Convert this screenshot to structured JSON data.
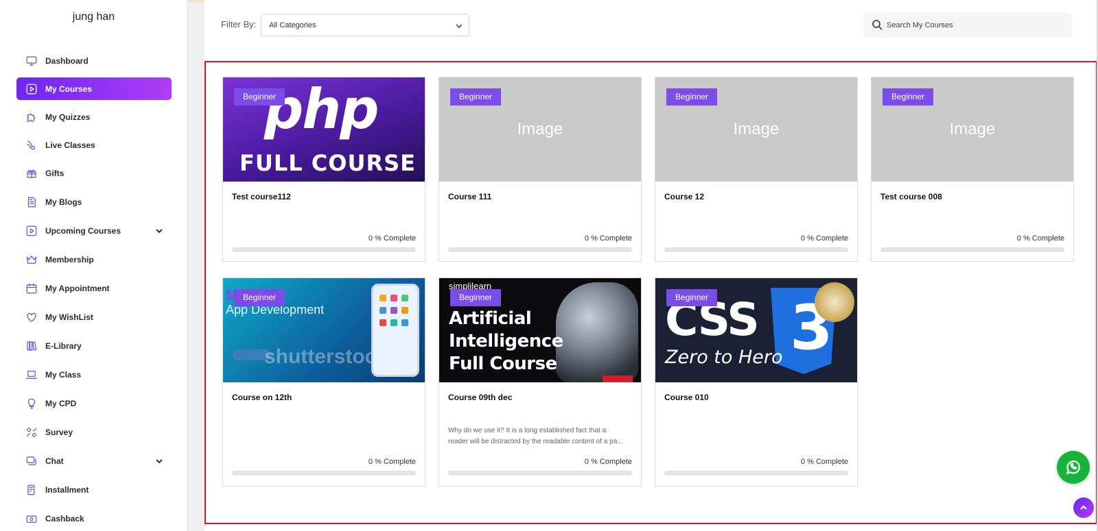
{
  "user": {
    "name": "jung han"
  },
  "sidebar": {
    "items": [
      {
        "label": "Dashboard",
        "icon": "monitor-icon",
        "active": false
      },
      {
        "label": "My Courses",
        "icon": "play-square-icon",
        "active": true
      },
      {
        "label": "My Quizzes",
        "icon": "puzzle-icon",
        "active": false
      },
      {
        "label": "Live Classes",
        "icon": "live-icon",
        "active": false
      },
      {
        "label": "Gifts",
        "icon": "gift-icon",
        "active": false
      },
      {
        "label": "My Blogs",
        "icon": "blog-icon",
        "active": false
      },
      {
        "label": "Upcoming Courses",
        "icon": "play-square-icon",
        "active": false,
        "expandable": true
      },
      {
        "label": "Membership",
        "icon": "crown-icon",
        "active": false
      },
      {
        "label": "My Appointment",
        "icon": "calendar-icon",
        "active": false
      },
      {
        "label": "My WishList",
        "icon": "heart-icon",
        "active": false
      },
      {
        "label": "E-Library",
        "icon": "books-icon",
        "active": false
      },
      {
        "label": "My Class",
        "icon": "laptop-icon",
        "active": false
      },
      {
        "label": "My CPD",
        "icon": "bulb-icon",
        "active": false
      },
      {
        "label": "Survey",
        "icon": "survey-icon",
        "active": false
      },
      {
        "label": "Chat",
        "icon": "chat-icon",
        "active": false,
        "expandable": true
      },
      {
        "label": "Installment",
        "icon": "installment-icon",
        "active": false
      },
      {
        "label": "Cashback",
        "icon": "cashback-icon",
        "active": false
      }
    ]
  },
  "filter": {
    "label": "Filter By:",
    "selected": "All Categories"
  },
  "search": {
    "placeholder": "Search My Courses"
  },
  "courses": [
    {
      "title": "Test course112",
      "level": "Beginner",
      "thumbnail": "php-full-course",
      "progress": 0,
      "progress_text": "0 % Complete",
      "description": ""
    },
    {
      "title": "Course 111",
      "level": "Beginner",
      "thumbnail": "placeholder",
      "placeholder_text": "Image",
      "progress": 0,
      "progress_text": "0 % Complete",
      "description": ""
    },
    {
      "title": "Course 12",
      "level": "Beginner",
      "thumbnail": "placeholder",
      "placeholder_text": "Image",
      "progress": 0,
      "progress_text": "0 % Complete",
      "description": ""
    },
    {
      "title": "Test course 008",
      "level": "Beginner",
      "thumbnail": "placeholder",
      "placeholder_text": "Image",
      "progress": 0,
      "progress_text": "0 % Complete",
      "description": ""
    },
    {
      "title": "Course on 12th",
      "level": "Beginner",
      "thumbnail": "mobile-app-development",
      "progress": 0,
      "progress_text": "0 % Complete",
      "description": ""
    },
    {
      "title": "Course 09th dec",
      "level": "Beginner",
      "thumbnail": "artificial-intelligence",
      "progress": 0,
      "progress_text": "0 % Complete",
      "description_line1": "Why do we use it? It is a long established fact that a",
      "description_line2": "reader will be distracted by the readable content of a pa..."
    },
    {
      "title": "Course 010",
      "level": "Beginner",
      "thumbnail": "css-zero-to-hero",
      "progress": 0,
      "progress_text": "0 % Complete",
      "description": ""
    }
  ],
  "thumb_text": {
    "php": "php",
    "php_full": "FULL COURSE",
    "mobile_1": "Mobile",
    "mobile_2": "App Development",
    "mobile_watermark": "shutterstock",
    "ai_brand": "simplilearn",
    "ai_line1": "Artificial",
    "ai_line2": "Intelligence",
    "ai_line3": "Full Course",
    "css": "CSS",
    "css_zero": "Zero to Hero",
    "css_shield": "3"
  },
  "colors": {
    "accent": "#7c4ce8",
    "active_gradient_start": "#6c27f0",
    "active_gradient_end": "#b13cf5",
    "highlight_border": "#e0141e",
    "whatsapp": "#18b33b"
  }
}
